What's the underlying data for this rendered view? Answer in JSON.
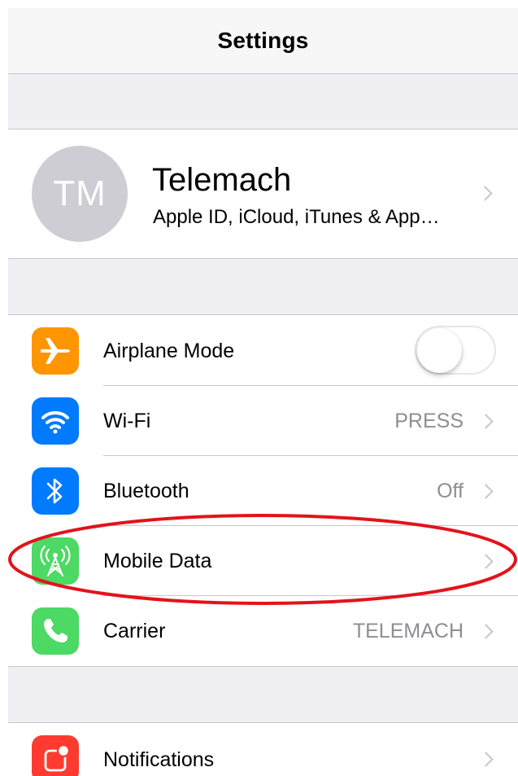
{
  "navbar": {
    "title": "Settings"
  },
  "profile": {
    "initials": "TM",
    "name": "Telemach",
    "subtitle": "Apple ID, iCloud, iTunes & App…"
  },
  "group1": [
    {
      "id": "airplane",
      "label": "Airplane Mode",
      "icon": "airplane-icon",
      "icon_color": "#ff9500",
      "toggle_on": false
    },
    {
      "id": "wifi",
      "label": "Wi-Fi",
      "value": "PRESS",
      "icon": "wifi-icon",
      "icon_color": "#007aff"
    },
    {
      "id": "bluetooth",
      "label": "Bluetooth",
      "value": "Off",
      "icon": "bluetooth-icon",
      "icon_color": "#007aff"
    },
    {
      "id": "mobile-data",
      "label": "Mobile Data",
      "icon": "antenna-icon",
      "icon_color": "#4cd964"
    },
    {
      "id": "carrier",
      "label": "Carrier",
      "value": "TELEMACH",
      "icon": "phone-icon",
      "icon_color": "#4cd964"
    }
  ],
  "group2": [
    {
      "id": "notifications",
      "label": "Notifications",
      "icon": "notifications-icon",
      "icon_color": "#ff3b30"
    }
  ],
  "annotation": {
    "highlight_color": "#e3131b",
    "target": "Mobile Data"
  }
}
